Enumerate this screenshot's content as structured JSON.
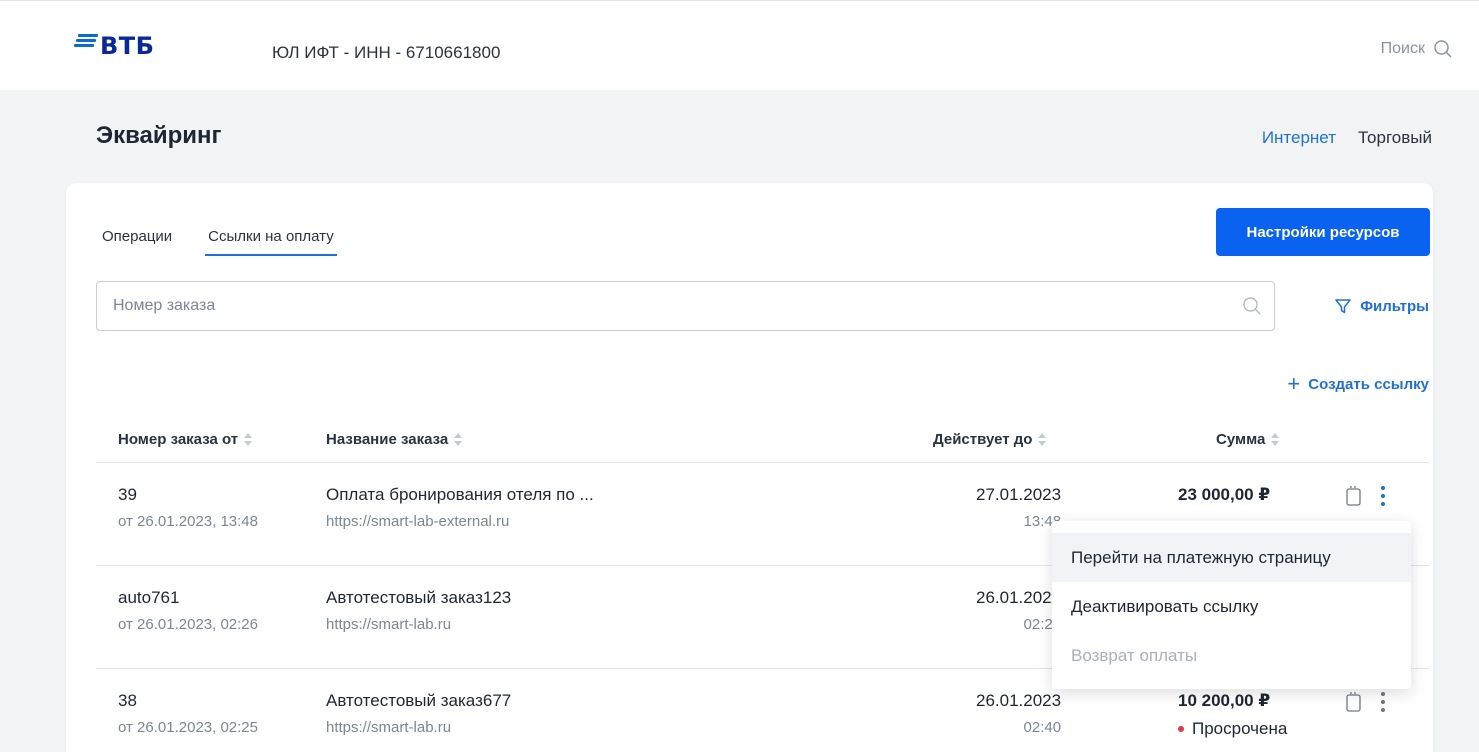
{
  "header": {
    "logo_text": "ВТБ",
    "company": "ЮЛ ИФТ - ИНН - 6710661800",
    "search_label": "Поиск"
  },
  "page": {
    "title": "Эквайринг",
    "type_options": [
      "Интернет",
      "Торговый"
    ],
    "active_type": "Интернет"
  },
  "tabs": [
    "Операции",
    "Ссылки на оплату"
  ],
  "active_tab": "Ссылки на оплату",
  "resource_button": "Настройки ресурсов",
  "search": {
    "placeholder": "Номер заказа"
  },
  "filters_label": "Фильтры",
  "create_link_label": "Создать ссылку",
  "table": {
    "columns": [
      "Номер заказа от",
      "Название заказа",
      "Действует до",
      "Сумма"
    ],
    "rows": [
      {
        "number": "39",
        "created": "от 26.01.2023, 13:48",
        "name": "Оплата бронирования отеля по ...",
        "url": "https://smart-lab-external.ru",
        "valid_date": "27.01.2023",
        "valid_time": "13:48",
        "amount": "23 000,00 ₽",
        "status": ""
      },
      {
        "number": "auto761",
        "created": "от 26.01.2023, 02:26",
        "name": "Автотестовый заказ123",
        "url": "https://smart-lab.ru",
        "valid_date": "26.01.2023",
        "valid_time": "02:26",
        "amount": "",
        "status": ""
      },
      {
        "number": "38",
        "created": "от 26.01.2023, 02:25",
        "name": "Автотестовый заказ677",
        "url": "https://smart-lab.ru",
        "valid_date": "26.01.2023",
        "valid_time": "02:40",
        "amount": "10 200,00 ₽",
        "status": "Просрочена"
      }
    ]
  },
  "context_menu": {
    "items": [
      "Перейти на платежную страницу",
      "Деактивировать ссылку",
      "Возврат оплаты"
    ]
  },
  "colors": {
    "accent": "#1f70d6",
    "primary_button": "#0a63f0",
    "brand": "#0a2896",
    "overdue_dot": "#e5394a"
  }
}
